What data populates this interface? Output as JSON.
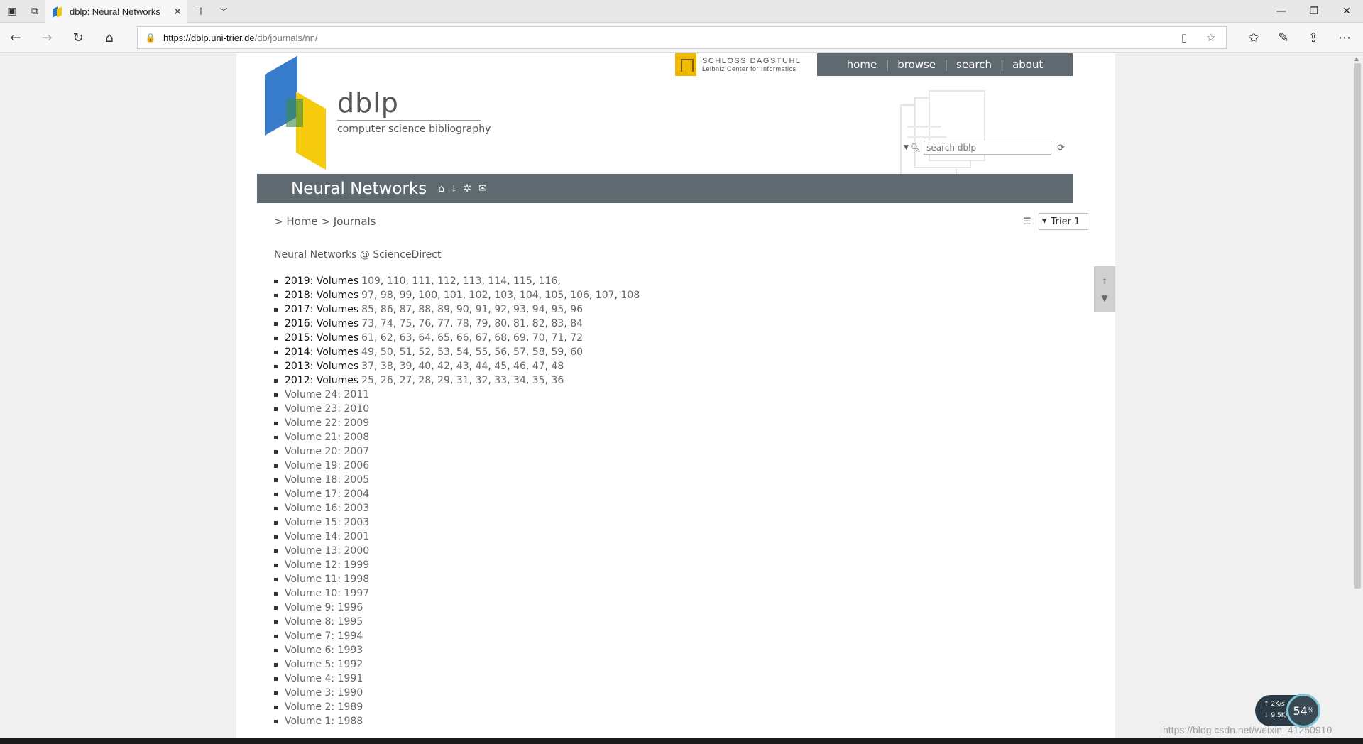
{
  "browser": {
    "tab_title": "dblp: Neural Networks",
    "url_host": "https://dblp.uni-trier.de",
    "url_path": "/db/journals/nn/"
  },
  "header": {
    "dagstuhl_name": "SCHLOSS DAGSTUHL",
    "dagstuhl_sub": "Leibniz Center for Informatics",
    "nav": [
      "home",
      "browse",
      "search",
      "about"
    ],
    "brand": "dblp",
    "brand_sub": "computer science bibliography",
    "search_placeholder": "search dblp"
  },
  "title": "Neural Networks",
  "breadcrumb": {
    "sep": ">",
    "home": "Home",
    "journals": "Journals"
  },
  "mirror": "Trier 1",
  "sciencedirect": "Neural Networks @ ScienceDirect",
  "volume_groups": [
    {
      "label": "2019: Volumes",
      "vols": [
        "109",
        "110",
        "111",
        "112",
        "113",
        "114",
        "115",
        "116"
      ],
      "trailing": ","
    },
    {
      "label": "2018: Volumes",
      "vols": [
        "97",
        "98",
        "99",
        "100",
        "101",
        "102",
        "103",
        "104",
        "105",
        "106",
        "107",
        "108"
      ],
      "trailing": ""
    },
    {
      "label": "2017: Volumes",
      "vols": [
        "85",
        "86",
        "87",
        "88",
        "89",
        "90",
        "91",
        "92",
        "93",
        "94",
        "95",
        "96"
      ],
      "trailing": ""
    },
    {
      "label": "2016: Volumes",
      "vols": [
        "73",
        "74",
        "75",
        "76",
        "77",
        "78",
        "79",
        "80",
        "81",
        "82",
        "83",
        "84"
      ],
      "trailing": ""
    },
    {
      "label": "2015: Volumes",
      "vols": [
        "61",
        "62",
        "63",
        "64",
        "65",
        "66",
        "67",
        "68",
        "69",
        "70",
        "71",
        "72"
      ],
      "trailing": ""
    },
    {
      "label": "2014: Volumes",
      "vols": [
        "49",
        "50",
        "51",
        "52",
        "53",
        "54",
        "55",
        "56",
        "57",
        "58",
        "59",
        "60"
      ],
      "trailing": ""
    },
    {
      "label": "2013: Volumes",
      "vols": [
        "37",
        "38",
        "39",
        "40",
        "42",
        "43",
        "44",
        "45",
        "46",
        "47",
        "48"
      ],
      "trailing": ""
    },
    {
      "label": "2012: Volumes",
      "vols": [
        "25",
        "26",
        "27",
        "28",
        "29",
        "31",
        "32",
        "33",
        "34",
        "35",
        "36"
      ],
      "trailing": ""
    }
  ],
  "single_volumes": [
    "Volume 24: 2011",
    "Volume 23: 2010",
    "Volume 22: 2009",
    "Volume 21: 2008",
    "Volume 20: 2007",
    "Volume 19: 2006",
    "Volume 18: 2005",
    "Volume 17: 2004",
    "Volume 16: 2003",
    "Volume 15: 2003",
    "Volume 14: 2001",
    "Volume 13: 2000",
    "Volume 12: 1999",
    "Volume 11: 1998",
    "Volume 10: 1997",
    "Volume 9: 1996",
    "Volume 8: 1995",
    "Volume 7: 1994",
    "Volume 6: 1993",
    "Volume 5: 1992",
    "Volume 4: 1991",
    "Volume 3: 1990",
    "Volume 2: 1989",
    "Volume 1: 1988"
  ],
  "overlay": {
    "up_speed": "2K/s",
    "down_speed": "9.5K/s",
    "cpu": "54",
    "cpu_unit": "%",
    "watermark": "https://blog.csdn.net/weixin_41250910"
  },
  "colors": {
    "header_bar": "#5f6a70",
    "logo_blue": "#2d76c9",
    "logo_yellow": "#f5c800"
  }
}
